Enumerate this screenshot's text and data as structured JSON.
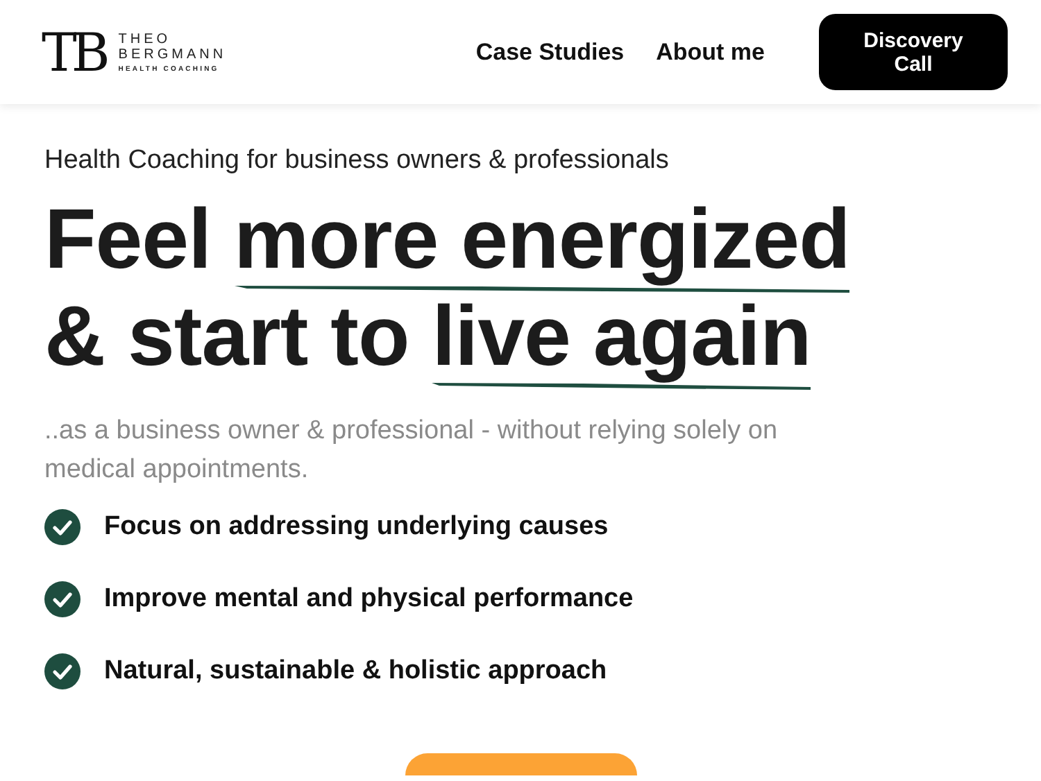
{
  "header": {
    "logo": {
      "monogram": "TB",
      "name_lines": [
        "THEO",
        "BERGMANN"
      ],
      "tagline": "HEALTH COACHING"
    },
    "nav": [
      {
        "label": "Case Studies"
      },
      {
        "label": "About me"
      }
    ],
    "cta": {
      "lines": [
        "Discovery",
        "Call"
      ]
    }
  },
  "hero": {
    "eyebrow": "Health Coaching for business owners & professionals",
    "headline": [
      {
        "plain": "Feel ",
        "underlined": "more energized"
      },
      {
        "plain": "& start to ",
        "underlined": "live again"
      }
    ],
    "subtitle": "..as a business owner & professional - without relying solely on medical appointments.",
    "benefits": [
      {
        "text": "Focus on addressing underlying causes"
      },
      {
        "text": "Improve mental and physical performance"
      },
      {
        "text": "Natural, sustainable & holistic approach"
      }
    ]
  }
}
